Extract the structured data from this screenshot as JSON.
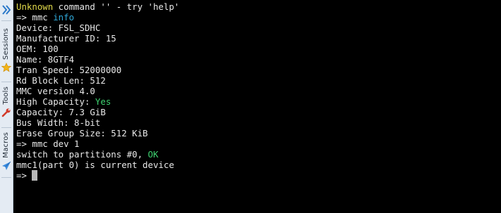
{
  "sidebar": {
    "expand_icon": "double-chevron-right-icon",
    "tabs": [
      {
        "label": "Sessions",
        "icon": "star-icon",
        "icon_color": "#f2b418"
      },
      {
        "label": "Tools",
        "icon": "wrench-icon",
        "icon_color": "#d23a2a"
      },
      {
        "label": "Macros",
        "icon": "paper-plane-icon",
        "icon_color": "#3c8de0"
      }
    ]
  },
  "terminal": {
    "colors": {
      "background": "#000000",
      "text": "#e8e8e8",
      "yellow": "#e0d94a",
      "cyan": "#2fa8d8",
      "green": "#3ed270",
      "cursor": "#b8b8b8"
    },
    "lines": [
      {
        "segments": [
          {
            "text": "Unknown",
            "color": "yellow"
          },
          {
            "text": " command '' - try 'help'"
          }
        ]
      },
      {
        "segments": [
          {
            "text": "=> mmc "
          },
          {
            "text": "info",
            "color": "cyan"
          }
        ]
      },
      {
        "segments": [
          {
            "text": "Device: FSL_SDHC"
          }
        ]
      },
      {
        "segments": [
          {
            "text": "Manufacturer ID: 15"
          }
        ]
      },
      {
        "segments": [
          {
            "text": "OEM: 100"
          }
        ]
      },
      {
        "segments": [
          {
            "text": "Name: 8GTF4"
          }
        ]
      },
      {
        "segments": [
          {
            "text": "Tran Speed: 52000000"
          }
        ]
      },
      {
        "segments": [
          {
            "text": "Rd Block Len: 512"
          }
        ]
      },
      {
        "segments": [
          {
            "text": "MMC version 4.0"
          }
        ]
      },
      {
        "segments": [
          {
            "text": "High Capacity: "
          },
          {
            "text": "Yes",
            "color": "green"
          }
        ]
      },
      {
        "segments": [
          {
            "text": "Capacity: 7.3 GiB"
          }
        ]
      },
      {
        "segments": [
          {
            "text": "Bus Width: 8-bit"
          }
        ]
      },
      {
        "segments": [
          {
            "text": "Erase Group Size: 512 KiB"
          }
        ]
      },
      {
        "segments": [
          {
            "text": "=> mmc dev 1"
          }
        ]
      },
      {
        "segments": [
          {
            "text": "switch to partitions #0, "
          },
          {
            "text": "OK",
            "color": "green"
          }
        ]
      },
      {
        "segments": [
          {
            "text": "mmc1(part 0) is current device"
          }
        ]
      }
    ],
    "prompt": "=> "
  }
}
